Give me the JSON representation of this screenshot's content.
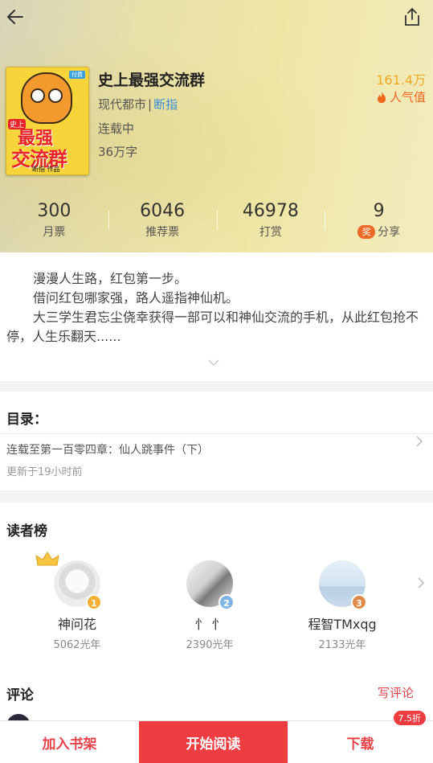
{
  "book": {
    "title": "史上最强交流群",
    "genre": "现代都市",
    "separator": "|",
    "tag": "断指",
    "status": "连载中",
    "word_count": "36万字",
    "popularity_value": "161.4万",
    "popularity_label": "人气值",
    "cover": {
      "line1": "史上",
      "line2": "最强",
      "line3": "交流群",
      "author_line": "断指 作品",
      "badge": "付费"
    }
  },
  "stats": [
    {
      "value": "300",
      "label": "月票"
    },
    {
      "value": "6046",
      "label": "推荐票"
    },
    {
      "value": "46978",
      "label": "打赏"
    },
    {
      "value": "9",
      "label": "分享",
      "badge": "奖"
    }
  ],
  "synopsis": {
    "lines": [
      "漫漫人生路，红包第一步。",
      "借问红包哪家强，路人遥指神仙机。",
      "大三学生君忘尘侥幸获得一部可以和神仙交流的手机，从此红包抢不停，人生乐翻天......"
    ]
  },
  "catalog": {
    "heading": "目录：",
    "latest_chapter": "连载至第一百零四章：仙人跳事件（下）",
    "updated": "更新于19小时前"
  },
  "readers": {
    "heading": "读者榜",
    "items": [
      {
        "name": "神问花",
        "points": "5062光年",
        "rank": "1",
        "medal_color": "#f2b134",
        "avatar_color": "#e6e6e6"
      },
      {
        "name": "忄 忄",
        "points": "2390光年",
        "rank": "2",
        "medal_color": "#7fb6e6",
        "avatar_color": "#dcdcdc"
      },
      {
        "name": "程智TMxqg",
        "points": "2133光年",
        "rank": "3",
        "medal_color": "#e08a4a",
        "avatar_color": "#d7e6f4"
      }
    ]
  },
  "comments": {
    "heading": "评论",
    "write_label": "写评论"
  },
  "bottom_bar": {
    "add_shelf": "加入书架",
    "start_reading": "开始阅读",
    "download": "下载",
    "discount": "7.5折"
  }
}
